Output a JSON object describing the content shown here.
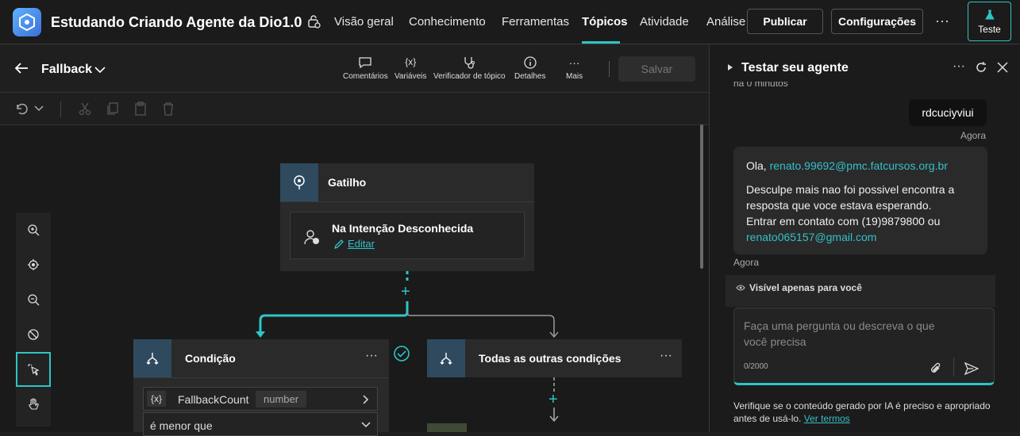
{
  "header": {
    "app_title": "Estudando Criando Agente da Dio1.0",
    "nav": [
      "Visão geral",
      "Conhecimento",
      "Ferramentas",
      "Tópicos",
      "Atividade",
      "Análise"
    ],
    "publish_label": "Publicar",
    "settings_label": "Configurações",
    "more_label": "···",
    "test_label": "Teste"
  },
  "editor": {
    "topic_name": "Fallback",
    "tools": [
      "Comentários",
      "Variáveis",
      "Verificador de tópico",
      "Detalhes",
      "Mais"
    ],
    "save_label": "Salvar",
    "trigger": {
      "title": "Gatilho",
      "event": "Na Intenção Desconhecida",
      "edit_label": "Editar"
    },
    "condition": {
      "title": "Condição",
      "variable": "FallbackCount",
      "var_type": "number",
      "operator": "é menor que"
    },
    "other": {
      "title": "Todas as outras condições"
    },
    "plus": "+",
    "var_badge": "{x}"
  },
  "test_panel": {
    "title": "Testar seu agente",
    "partial_time": "há 0 minutos",
    "user_message": "rdcuciyviui",
    "user_time": "Agora",
    "bot_greeting": "Ola,",
    "bot_email": "renato.99692@pmc.fatcursos.org.br",
    "bot_line1": "Desculpe mais nao foi possivel encontra a resposta que voce estava esperando.",
    "bot_line2": "Entrar em contato com (19)9879800 ou",
    "bot_email2": "renato065157@gmail.com",
    "bot_time": "Agora",
    "visible_only": "Visível apenas para você",
    "input_placeholder": "Faça uma pergunta ou descreva o que você precisa",
    "counter": "0/2000",
    "disclaimer": "Verifique se o conteúdo gerado por IA é preciso e apropriado antes de usá-lo.",
    "terms_link": "Ver termos"
  },
  "colors": {
    "accent": "#2ec5c5",
    "node_icon_bg": "#2f4a5e",
    "link": "#35c0c8"
  }
}
